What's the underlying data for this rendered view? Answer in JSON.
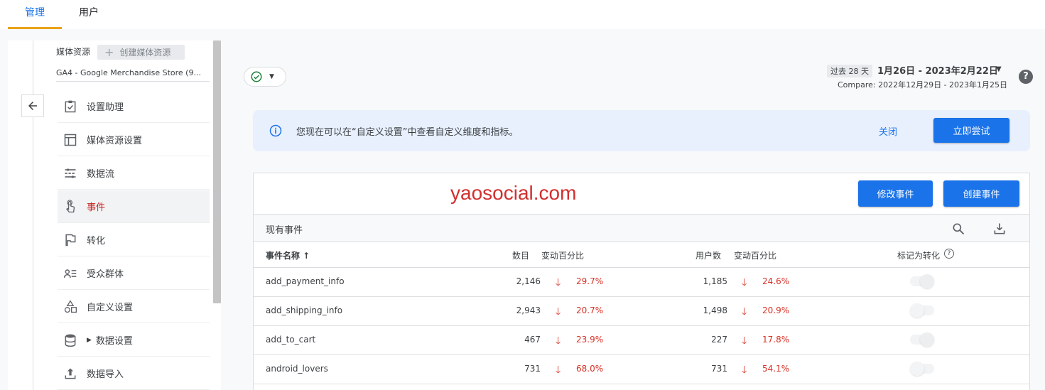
{
  "tabs": [
    {
      "label": "管理",
      "active": true
    },
    {
      "label": "用户",
      "active": false
    }
  ],
  "sidebar": {
    "resource_label": "媒体资源",
    "create_resource_label": "创建媒体资源",
    "resource_name": "GA4 - Google Merchandise Store (9...",
    "items": [
      {
        "label": "设置助理",
        "icon": "checklist-icon"
      },
      {
        "label": "媒体资源设置",
        "icon": "layout-icon"
      },
      {
        "label": "数据流",
        "icon": "data-stream-icon"
      },
      {
        "label": "事件",
        "icon": "touch-icon",
        "active": true
      },
      {
        "label": "转化",
        "icon": "flag-icon"
      },
      {
        "label": "受众群体",
        "icon": "audience-icon"
      },
      {
        "label": "自定义设置",
        "icon": "shapes-icon"
      },
      {
        "label": "数据设置",
        "icon": "database-icon"
      },
      {
        "label": "数据导入",
        "icon": "upload-icon"
      }
    ]
  },
  "header": {
    "date_chip": "过去 28 天",
    "date_range": "1月26日 - 2023年2月22日",
    "compare": "Compare: 2022年12月29日 - 2023年1月25日",
    "help": "?"
  },
  "banner": {
    "message": "您现在可以在“自定义设置”中查看自定义维度和指标。",
    "close_label": "关闭",
    "try_label": "立即尝试"
  },
  "card": {
    "watermark": "yaosocial.com",
    "modify_label": "修改事件",
    "create_label": "创建事件",
    "title": "现有事件",
    "columns": {
      "name": "事件名称 ↑",
      "count": "数目",
      "count_change": "变动百分比",
      "users": "用户数",
      "users_change": "变动百分比",
      "mark": "标记为转化"
    },
    "rows": [
      {
        "name": "add_payment_info",
        "count": "2,146",
        "count_change": "29.7%",
        "users": "1,185",
        "users_change": "24.6%",
        "conversion": true
      },
      {
        "name": "add_shipping_info",
        "count": "2,943",
        "count_change": "20.7%",
        "users": "1,498",
        "users_change": "20.9%",
        "conversion": false
      },
      {
        "name": "add_to_cart",
        "count": "467",
        "count_change": "23.9%",
        "users": "227",
        "users_change": "17.8%",
        "conversion": true
      },
      {
        "name": "android_lovers",
        "count": "731",
        "count_change": "68.0%",
        "users": "731",
        "users_change": "54.1%",
        "conversion": false
      }
    ]
  },
  "colors": {
    "accent": "#1a73e8",
    "tab_underline": "#e8a317",
    "negative": "#d93025",
    "watermark": "#d32f2f"
  }
}
